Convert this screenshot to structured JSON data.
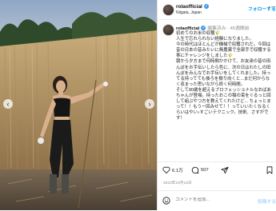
{
  "header": {
    "username": "rolaofficial",
    "location": "Niigata, Japan",
    "follow_label": "フォローする",
    "more_icon": "more-dots-icon"
  },
  "caption": {
    "username": "rolaofficial",
    "edited": "編集済み · 45週間前",
    "text": "初めてのお米の収穫🌾\n人生で忘れられない経験になりました。\n今の時代はほとんどが機械で収穫されだ。今回は昔の日本の昔みたいに無農薬で全部手で収穫する事にチャレンジをしました🌾\n朝から夕方まで何時間かかけて、お友達の皆の田んぼをお手伝いしたら色に、次の日はわたしの田んぼをみんなでお手伝いをしてくれました。持ってる持ってても後ろを振り向くと...まだ何からなく収まった思いながら終く何時間。\nそして80歳を超えるプロフェッショナルなおばあちゃんが登場。持ったおこの稲の束をぐるっと回して組ぶやつ方を教えてくれたけど... ちょっとまって！！もう一回みせて！！っていいたくなるくらいはやい♪すごいテクニック。技術、さすがです！"
  },
  "actions": {
    "likes": "6.1万",
    "comments": "507",
    "date": "2023年10月12日",
    "heart_icon": "heart-icon",
    "comment_icon": "comment-icon",
    "share_icon": "share-icon",
    "save_icon": "bookmark-icon"
  },
  "comment_box": {
    "placeholder": "コメントを追加...",
    "post_label": "投稿する"
  },
  "colors": {
    "accent": "#0095f6",
    "verified": "#3897f0"
  }
}
